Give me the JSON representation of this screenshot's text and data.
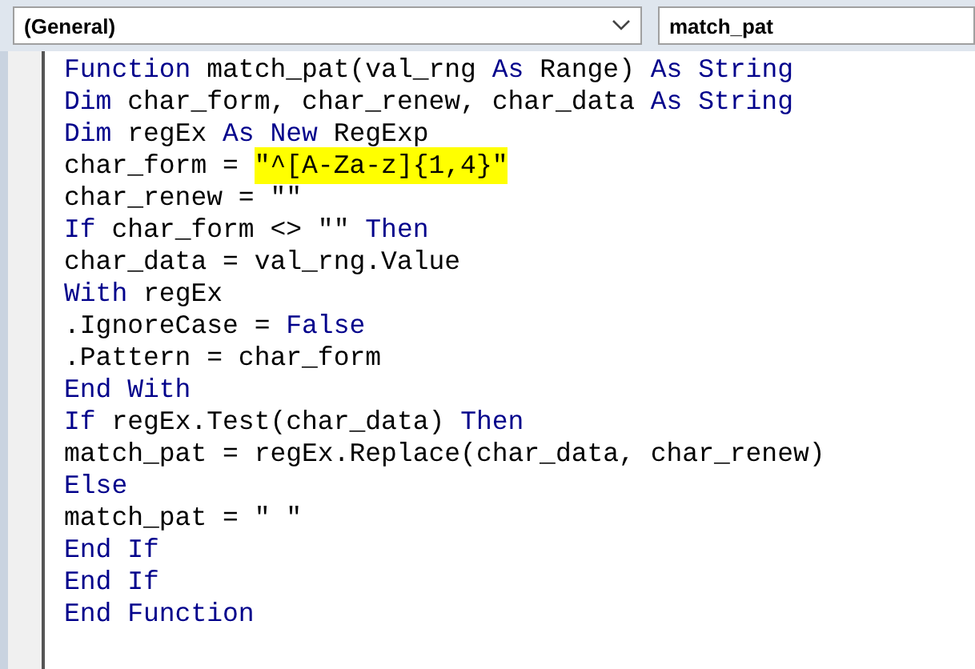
{
  "object_dropdown": {
    "value": "(General)"
  },
  "procedure_dropdown": {
    "value": "match_pat"
  },
  "code_lines": [
    {
      "tokens": [
        {
          "text": "Function",
          "kind": "keyword"
        },
        {
          "text": " match_pat(val_rng ",
          "kind": "plain"
        },
        {
          "text": "As",
          "kind": "keyword"
        },
        {
          "text": " Range) ",
          "kind": "plain"
        },
        {
          "text": "As String",
          "kind": "keyword"
        }
      ]
    },
    {
      "tokens": [
        {
          "text": "Dim",
          "kind": "keyword"
        },
        {
          "text": " char_form, char_renew, char_data ",
          "kind": "plain"
        },
        {
          "text": "As String",
          "kind": "keyword"
        }
      ]
    },
    {
      "tokens": [
        {
          "text": "Dim",
          "kind": "keyword"
        },
        {
          "text": " regEx ",
          "kind": "plain"
        },
        {
          "text": "As New",
          "kind": "keyword"
        },
        {
          "text": " RegExp",
          "kind": "plain"
        }
      ]
    },
    {
      "tokens": [
        {
          "text": "char_form = ",
          "kind": "plain"
        },
        {
          "text": "\"^[A-Za-z]{1,4}\"",
          "kind": "highlight"
        }
      ]
    },
    {
      "tokens": [
        {
          "text": "char_renew = \"\"",
          "kind": "plain"
        }
      ]
    },
    {
      "tokens": [
        {
          "text": "If",
          "kind": "keyword"
        },
        {
          "text": " char_form <> \"\" ",
          "kind": "plain"
        },
        {
          "text": "Then",
          "kind": "keyword"
        }
      ]
    },
    {
      "tokens": [
        {
          "text": "char_data = val_rng.Value",
          "kind": "plain"
        }
      ]
    },
    {
      "tokens": [
        {
          "text": "With",
          "kind": "keyword"
        },
        {
          "text": " regEx",
          "kind": "plain"
        }
      ]
    },
    {
      "tokens": [
        {
          "text": ".IgnoreCase = ",
          "kind": "plain"
        },
        {
          "text": "False",
          "kind": "keyword"
        }
      ]
    },
    {
      "tokens": [
        {
          "text": ".Pattern = char_form",
          "kind": "plain"
        }
      ]
    },
    {
      "tokens": [
        {
          "text": "End With",
          "kind": "keyword"
        }
      ]
    },
    {
      "tokens": [
        {
          "text": "If",
          "kind": "keyword"
        },
        {
          "text": " regEx.Test(char_data) ",
          "kind": "plain"
        },
        {
          "text": "Then",
          "kind": "keyword"
        }
      ]
    },
    {
      "tokens": [
        {
          "text": "match_pat = regEx.Replace(char_data, char_renew)",
          "kind": "plain"
        }
      ]
    },
    {
      "tokens": [
        {
          "text": "Else",
          "kind": "keyword"
        }
      ]
    },
    {
      "tokens": [
        {
          "text": "match_pat = \" \"",
          "kind": "plain"
        }
      ]
    },
    {
      "tokens": [
        {
          "text": "End If",
          "kind": "keyword"
        }
      ]
    },
    {
      "tokens": [
        {
          "text": "End If",
          "kind": "keyword"
        }
      ]
    },
    {
      "tokens": [
        {
          "text": "End Function",
          "kind": "keyword"
        }
      ]
    }
  ]
}
